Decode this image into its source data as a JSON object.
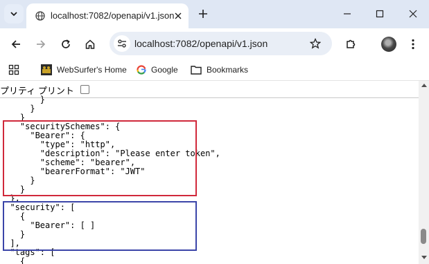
{
  "tab": {
    "title": "localhost:7082/openapi/v1.json",
    "favicon": "globe-icon"
  },
  "window_controls": [
    "minimize-icon",
    "maximize-icon",
    "close-icon"
  ],
  "toolbar": {
    "url": "localhost:7082/openapi/v1.json",
    "icons": [
      "back-arrow-icon",
      "forward-arrow-icon",
      "reload-icon",
      "home-icon",
      "site-settings-icon",
      "star-icon",
      "extensions-icon",
      "profile-avatar",
      "kebab-menu-icon"
    ]
  },
  "bookmarks": {
    "items": [
      {
        "label": "WebSurfer's Home",
        "icon": "websurfer-favicon"
      },
      {
        "label": "Google",
        "icon": "google-g-icon"
      },
      {
        "label": "Bookmarks",
        "icon": "folder-icon"
      }
    ]
  },
  "page": {
    "pretty_print_label": "プリティ プリント",
    "pretty_print_checked": false,
    "json_lines": [
      "        }",
      "      }",
      "    }",
      "    \"securitySchemes\": {",
      "      \"Bearer\": {",
      "        \"type\": \"http\",",
      "        \"description\": \"Please enter token\",",
      "        \"scheme\": \"bearer\",",
      "        \"bearerFormat\": \"JWT\"",
      "      }",
      "    }",
      "  },",
      "  \"security\": [",
      "    {",
      "      \"Bearer\": [ ]",
      "    }",
      "  ],",
      "  \"tags\": [",
      "    {"
    ]
  },
  "highlights": {
    "red": "#d0283a",
    "blue": "#3a44a8"
  }
}
